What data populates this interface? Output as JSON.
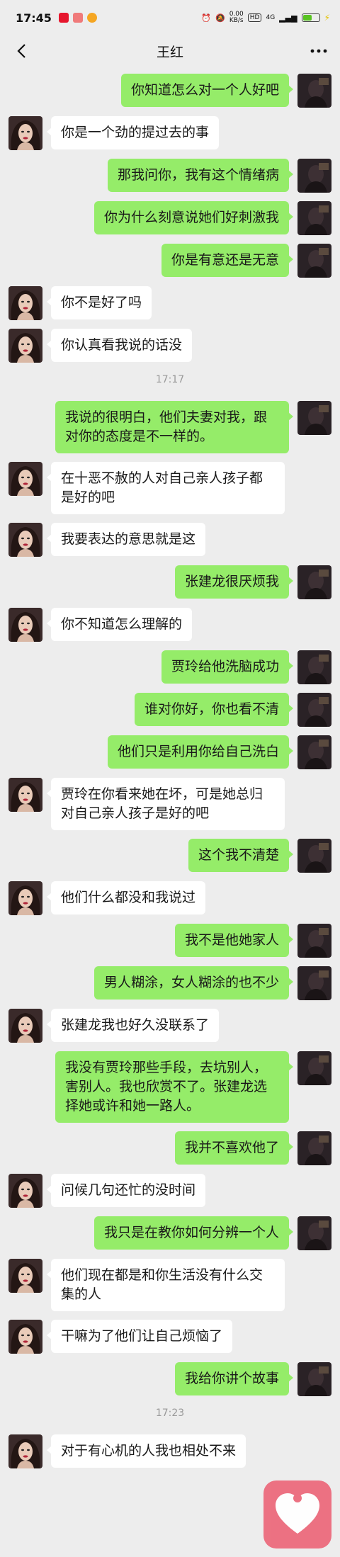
{
  "status_bar": {
    "time": "17:45",
    "net_speed": "0.00\nKB/s",
    "hd_tag": "HD",
    "signal_tag": "4G",
    "battery_color": "#58c322"
  },
  "header": {
    "title": "王红",
    "back_icon": "chevron-left-icon",
    "more_icon": "more-dots-icon"
  },
  "colors": {
    "me_bubble": "#95ec69",
    "other_bubble": "#ffffff",
    "background": "#ededed",
    "float_button": "#ec6b7d"
  },
  "messages": [
    {
      "from": "me",
      "text": "你知道怎么对一个人好吧"
    },
    {
      "from": "other",
      "text": "你是一个劲的提过去的事"
    },
    {
      "from": "me",
      "text": "那我问你，我有这个情绪病"
    },
    {
      "from": "me",
      "text": "你为什么刻意说她们好刺激我"
    },
    {
      "from": "me",
      "text": "你是有意还是无意"
    },
    {
      "from": "other",
      "text": "你不是好了吗"
    },
    {
      "from": "other",
      "text": "你认真看我说的话没"
    },
    {
      "from": "time",
      "text": "17:17"
    },
    {
      "from": "me",
      "text": "我说的很明白，他们夫妻对我，跟对你的态度是不一样的。"
    },
    {
      "from": "other",
      "text": "在十恶不赦的人对自己亲人孩子都是好的吧"
    },
    {
      "from": "other",
      "text": "我要表达的意思就是这"
    },
    {
      "from": "me",
      "text": "张建龙很厌烦我"
    },
    {
      "from": "other",
      "text": "你不知道怎么理解的"
    },
    {
      "from": "me",
      "text": "贾玲给他洗脑成功"
    },
    {
      "from": "me",
      "text": "谁对你好，你也看不清"
    },
    {
      "from": "me",
      "text": "他们只是利用你给自己洗白"
    },
    {
      "from": "other",
      "text": "贾玲在你看来她在坏，可是她总归对自己亲人孩子是好的吧"
    },
    {
      "from": "me",
      "text": "这个我不清楚"
    },
    {
      "from": "other",
      "text": "他们什么都没和我说过"
    },
    {
      "from": "me",
      "text": "我不是他她家人"
    },
    {
      "from": "me",
      "text": "男人糊涂，女人糊涂的也不少"
    },
    {
      "from": "other",
      "text": "张建龙我也好久没联系了"
    },
    {
      "from": "me",
      "text": "我没有贾玲那些手段，去坑别人，害别人。我也欣赏不了。张建龙选择她或许和她一路人。"
    },
    {
      "from": "me",
      "text": "我并不喜欢他了"
    },
    {
      "from": "other",
      "text": "问候几句还忙的没时间"
    },
    {
      "from": "me",
      "text": "我只是在教你如何分辨一个人"
    },
    {
      "from": "other",
      "text": "他们现在都是和你生活没有什么交集的人"
    },
    {
      "from": "other",
      "text": "干嘛为了他们让自己烦恼了"
    },
    {
      "from": "me",
      "text": "我给你讲个故事"
    },
    {
      "from": "time",
      "text": "17:23"
    },
    {
      "from": "other",
      "text": "对于有心机的人我也相处不来"
    }
  ],
  "float_button": {
    "icon": "heart-icon"
  }
}
